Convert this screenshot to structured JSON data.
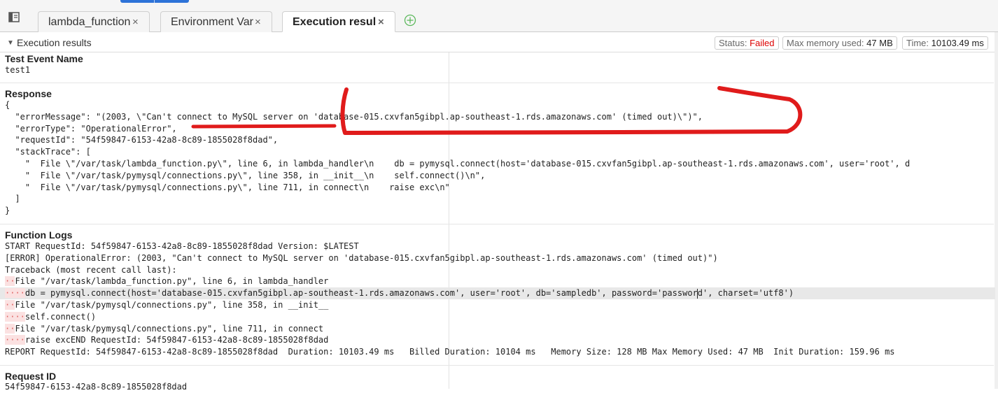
{
  "tabs": [
    {
      "label": "lambda_function",
      "close": "×"
    },
    {
      "label": "Environment Vari",
      "close": "×"
    },
    {
      "label": "Execution results",
      "close": "×"
    }
  ],
  "section": {
    "title": "Execution results",
    "status_label": "Status:",
    "status_value": "Failed",
    "memory_label": "Max memory used:",
    "memory_value": "47 MB",
    "time_label": "Time:",
    "time_value": "10103.49 ms"
  },
  "test_event": {
    "heading": "Test Event Name",
    "value": "test1"
  },
  "response": {
    "heading": "Response",
    "lines": [
      "{",
      "  \"errorMessage\": \"(2003, \\\"Can't connect to MySQL server on 'database-015.cxvfan5gibpl.ap-southeast-1.rds.amazonaws.com' (timed out)\\\")\",",
      "  \"errorType\": \"OperationalError\",",
      "  \"requestId\": \"54f59847-6153-42a8-8c89-1855028f8dad\",",
      "  \"stackTrace\": [",
      "    \"  File \\\"/var/task/lambda_function.py\\\", line 6, in lambda_handler\\n    db = pymysql.connect(host='database-015.cxvfan5gibpl.ap-southeast-1.rds.amazonaws.com', user='root', d",
      "    \"  File \\\"/var/task/pymysql/connections.py\\\", line 358, in __init__\\n    self.connect()\\n\",",
      "    \"  File \\\"/var/task/pymysql/connections.py\\\", line 711, in connect\\n    raise exc\\n\"",
      "  ]",
      "}"
    ]
  },
  "logs": {
    "heading": "Function Logs",
    "lines": [
      {
        "dots": "",
        "text": "START RequestId: 54f59847-6153-42a8-8c89-1855028f8dad Version: $LATEST"
      },
      {
        "dots": "",
        "text": "[ERROR] OperationalError: (2003, \"Can't connect to MySQL server on 'database-015.cxvfan5gibpl.ap-southeast-1.rds.amazonaws.com' (timed out)\")"
      },
      {
        "dots": "",
        "text": "Traceback (most recent call last):"
      },
      {
        "dots": "··",
        "text": "File \"/var/task/lambda_function.py\", line 6, in lambda_handler"
      },
      {
        "dots": "····",
        "text": "db = pymysql.connect(host='database-015.cxvfan5gibpl.ap-southeast-1.rds.amazonaws.com', user='root', db='sampledb', password='passwor",
        "tail": "d', charset='utf8')"
      },
      {
        "dots": "··",
        "text": "File \"/var/task/pymysql/connections.py\", line 358, in __init__"
      },
      {
        "dots": "····",
        "text": "self.connect()"
      },
      {
        "dots": "··",
        "text": "File \"/var/task/pymysql/connections.py\", line 711, in connect"
      },
      {
        "dots": "····",
        "text": "raise excEND RequestId: 54f59847-6153-42a8-8c89-1855028f8dad"
      },
      {
        "dots": "",
        "text": "REPORT RequestId: 54f59847-6153-42a8-8c89-1855028f8dad  Duration: 10103.49 ms   Billed Duration: 10104 ms   Memory Size: 128 MB Max Memory Used: 47 MB  Init Duration: 159.96 ms"
      }
    ]
  },
  "request": {
    "heading": "Request ID",
    "value": "54f59847-6153-42a8-8c89-1855028f8dad"
  },
  "icons": {
    "menu": "menu-icon",
    "add": "add-tab-icon",
    "collapse": "collapse-triangle-icon"
  },
  "colors": {
    "failed": "#dd0000",
    "annotation": "#e01b1b",
    "tab_strip": "#2e73d8"
  }
}
